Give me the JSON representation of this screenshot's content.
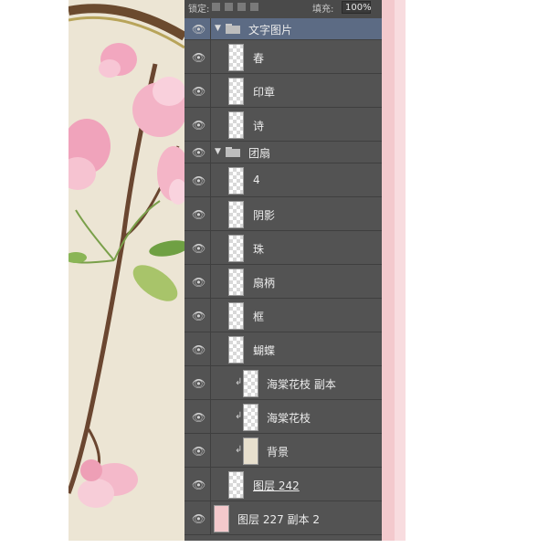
{
  "panel": {
    "topbar": {
      "lock_label": "锁定:",
      "fill_label": "填充:",
      "fill_value": "100%"
    },
    "layers": [
      {
        "name": "文字图片",
        "kind": "group",
        "selected": true
      },
      {
        "name": "春",
        "kind": "layer"
      },
      {
        "name": "印章",
        "kind": "layer"
      },
      {
        "name": "诗",
        "kind": "layer"
      },
      {
        "name": "团扇",
        "kind": "group"
      },
      {
        "name": "4",
        "kind": "layer"
      },
      {
        "name": "阴影",
        "kind": "layer"
      },
      {
        "name": "珠",
        "kind": "layer"
      },
      {
        "name": "扇柄",
        "kind": "layer"
      },
      {
        "name": "框",
        "kind": "layer"
      },
      {
        "name": "蝴蝶",
        "kind": "layer"
      },
      {
        "name": "海棠花枝 副本",
        "kind": "clipped"
      },
      {
        "name": "海棠花枝",
        "kind": "clipped"
      },
      {
        "name": "背景",
        "kind": "clipped"
      },
      {
        "name": "图层 242",
        "kind": "layer"
      },
      {
        "name": "图层 227 副本 2",
        "kind": "layer"
      }
    ]
  },
  "colors": {
    "panel_bg": "#535353",
    "selected_row": "#5c6b84",
    "canvas_bg": "#ece5d4",
    "pink_strip": "#f3c9cd"
  }
}
